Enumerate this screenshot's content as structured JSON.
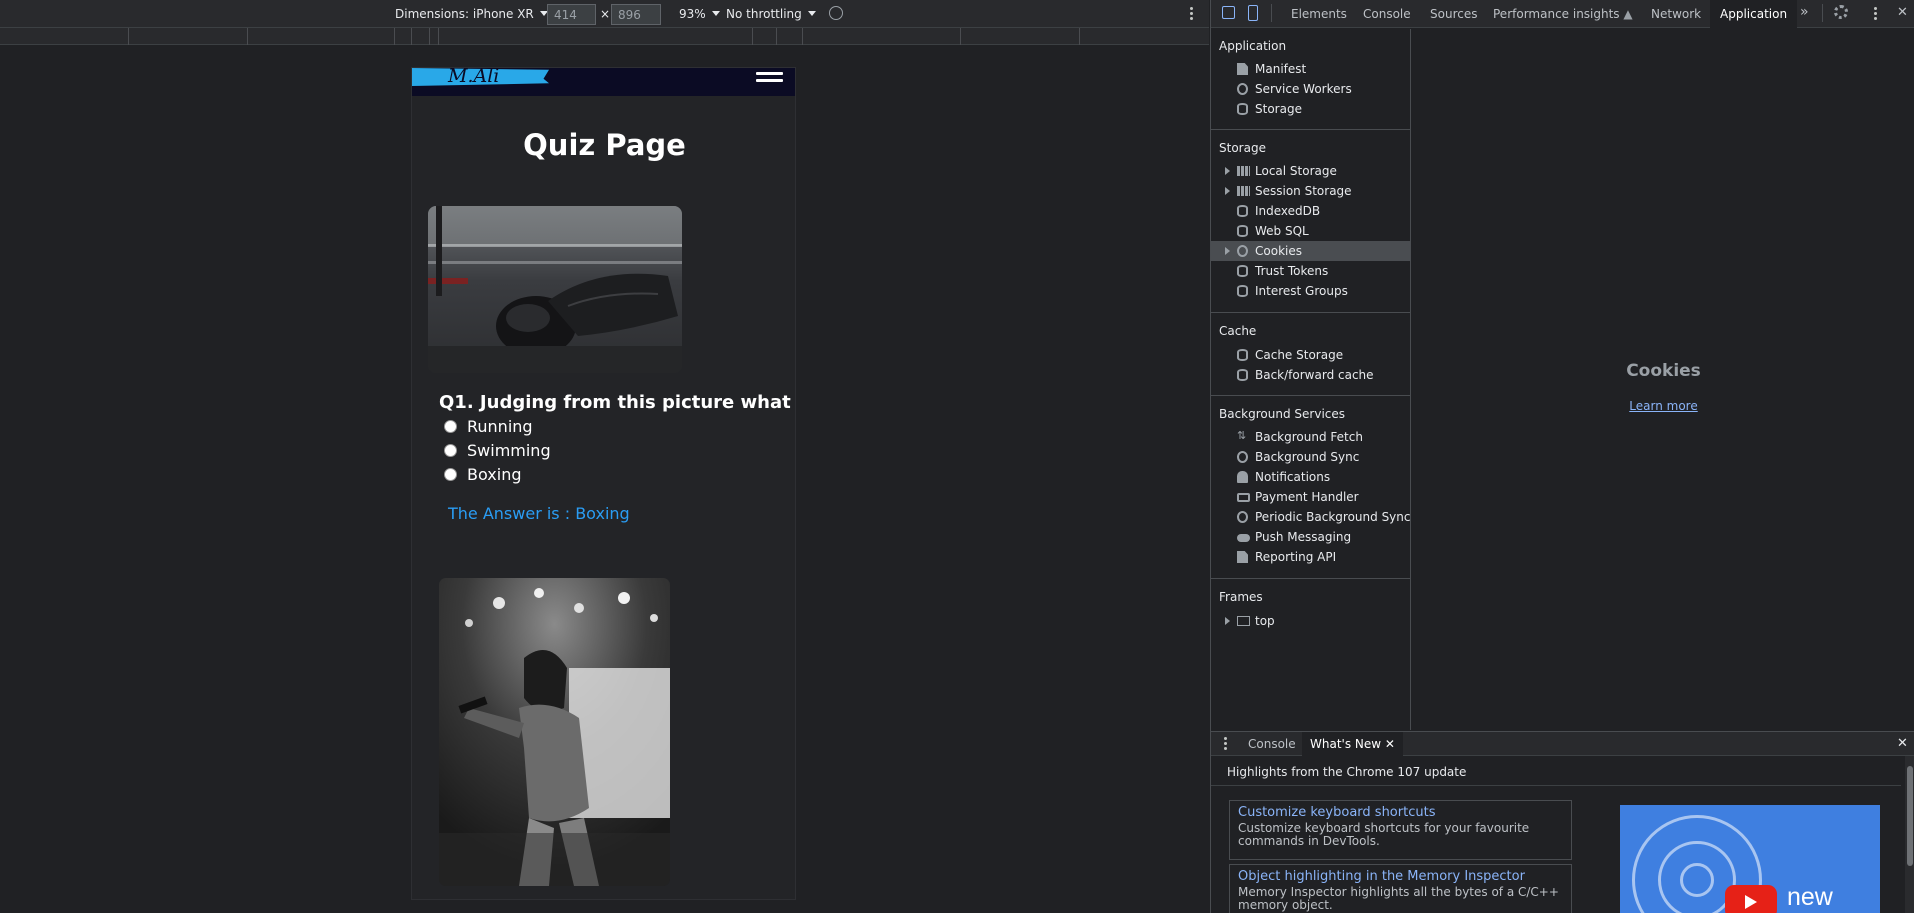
{
  "device_toolbar": {
    "dimensions_label": "Dimensions: iPhone XR",
    "width_value": "414",
    "times": "×",
    "height_value": "896",
    "zoom": "93%",
    "throttling": "No throttling"
  },
  "page": {
    "logo_text": "M.Ali",
    "title": "Quiz Page",
    "question": "Q1. Judging from this picture what",
    "options": [
      "Running",
      "Swimming",
      "Boxing"
    ],
    "answer": "The Answer is : Boxing"
  },
  "devtools": {
    "tabs": [
      "Elements",
      "Console",
      "Sources",
      "Performance insights",
      "Network",
      "Application"
    ],
    "active_tab": "Application",
    "sidebar": {
      "application_header": "Application",
      "application_items": [
        "Manifest",
        "Service Workers",
        "Storage"
      ],
      "storage_header": "Storage",
      "storage_items": [
        "Local Storage",
        "Session Storage",
        "IndexedDB",
        "Web SQL",
        "Cookies",
        "Trust Tokens",
        "Interest Groups"
      ],
      "cache_header": "Cache",
      "cache_items": [
        "Cache Storage",
        "Back/forward cache"
      ],
      "background_header": "Background Services",
      "background_items": [
        "Background Fetch",
        "Background Sync",
        "Notifications",
        "Payment Handler",
        "Periodic Background Sync",
        "Push Messaging",
        "Reporting API"
      ],
      "frames_header": "Frames",
      "frames_items": [
        "top"
      ]
    },
    "main": {
      "heading": "Cookies",
      "link": "Learn more"
    },
    "drawer": {
      "tabs": [
        "Console",
        "What's New"
      ],
      "highlights": "Highlights from the Chrome 107 update",
      "cards": [
        {
          "title": "Customize keyboard shortcuts",
          "desc": "Customize keyboard shortcuts for your favourite commands in DevTools."
        },
        {
          "title": "Object highlighting in the Memory Inspector",
          "desc": "Memory Inspector highlights all the bytes of a C/C++ memory object."
        }
      ],
      "promo_word": "new"
    }
  },
  "colors": {
    "accent_blue": "#2a9df4",
    "logo_blue": "#29a8e8",
    "navbar": "#0b0b24",
    "link": "#8ab4f8"
  }
}
